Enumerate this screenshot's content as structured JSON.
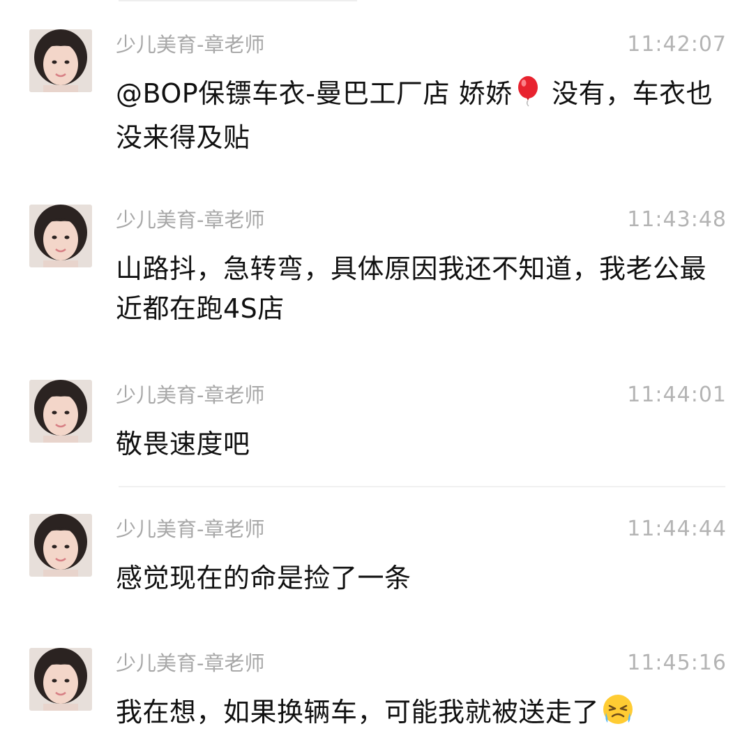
{
  "messages": [
    {
      "sender": "少儿美育-章老师",
      "time": "11:42:07",
      "text_before_emoji": "@BOP保镖车衣-曼巴工厂店 娇娇",
      "emoji": "balloon-icon",
      "text_after_emoji": " 没有，车衣也没来得及贴"
    },
    {
      "sender": "少儿美育-章老师",
      "time": "11:43:48",
      "text": "山路抖，急转弯，具体原因我还不知道，我老公最近都在跑4S店"
    },
    {
      "sender": "少儿美育-章老师",
      "time": "11:44:01",
      "text": "敬畏速度吧"
    },
    {
      "sender": "少儿美育-章老师",
      "time": "11:44:44",
      "text": "感觉现在的命是捡了一条"
    },
    {
      "sender": "少儿美育-章老师",
      "time": "11:45:16",
      "text_before_emoji": "我在想，如果换辆车，可能我就被送走了",
      "emoji": "crying-face-icon",
      "text_after_emoji": ""
    }
  ],
  "colors": {
    "sender": "#a8a8a8",
    "time": "#b4b4b4",
    "text": "#111111",
    "divider": "#f0f0f0"
  }
}
